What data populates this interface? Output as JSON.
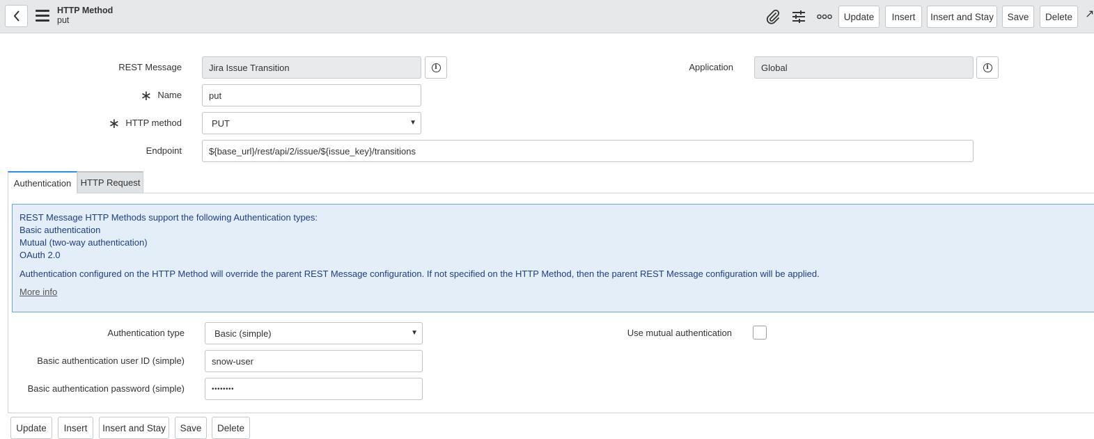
{
  "header": {
    "title": "HTTP Method",
    "subtitle": "put",
    "buttons": {
      "update": "Update",
      "insert": "Insert",
      "insert_and_stay": "Insert and Stay",
      "save": "Save",
      "delete": "Delete"
    },
    "icons": [
      "back-icon",
      "menu-icon",
      "paperclip-icon",
      "settings-sliders-icon",
      "more-options-icon"
    ]
  },
  "form": {
    "rest_message": {
      "label": "REST Message",
      "value": "Jira Issue Transition"
    },
    "application": {
      "label": "Application",
      "value": "Global"
    },
    "name": {
      "label": "Name",
      "value": "put",
      "required_mark": "∗"
    },
    "http_method": {
      "label": "HTTP method",
      "value": "PUT",
      "required_mark": "∗"
    },
    "endpoint": {
      "label": "Endpoint",
      "value": "${base_url}/rest/api/2/issue/${issue_key}/transitions"
    }
  },
  "tabs": [
    {
      "label": "Authentication",
      "active": true
    },
    {
      "label": "HTTP Request",
      "active": false
    }
  ],
  "info_box": {
    "lines": [
      "REST Message HTTP Methods support the following Authentication types:",
      "Basic authentication",
      "Mutual (two-way authentication)",
      "OAuth 2.0"
    ],
    "note": "Authentication configured on the HTTP Method will override the parent REST Message configuration. If not specified on the HTTP Method, then the parent REST Message configuration will be applied.",
    "more_info": "More info"
  },
  "auth": {
    "type": {
      "label": "Authentication type",
      "value": "Basic (simple)"
    },
    "mutual": {
      "label": "Use mutual authentication",
      "checked": false
    },
    "user_id": {
      "label": "Basic authentication user ID (simple)",
      "value": "snow-user"
    },
    "password": {
      "label": "Basic authentication password (simple)",
      "value": "••••••••"
    }
  },
  "footer": {
    "buttons": {
      "update": "Update",
      "insert": "Insert",
      "insert_and_stay": "Insert and Stay",
      "save": "Save",
      "delete": "Delete"
    }
  },
  "colors": {
    "header_bg": "#e6e8ea",
    "info_bg": "#e4eef9",
    "info_border": "#6ea5dc",
    "info_text": "#1e3f84",
    "active_tab_accent": "#278efc",
    "readonly_bg": "#e9eaeb"
  }
}
